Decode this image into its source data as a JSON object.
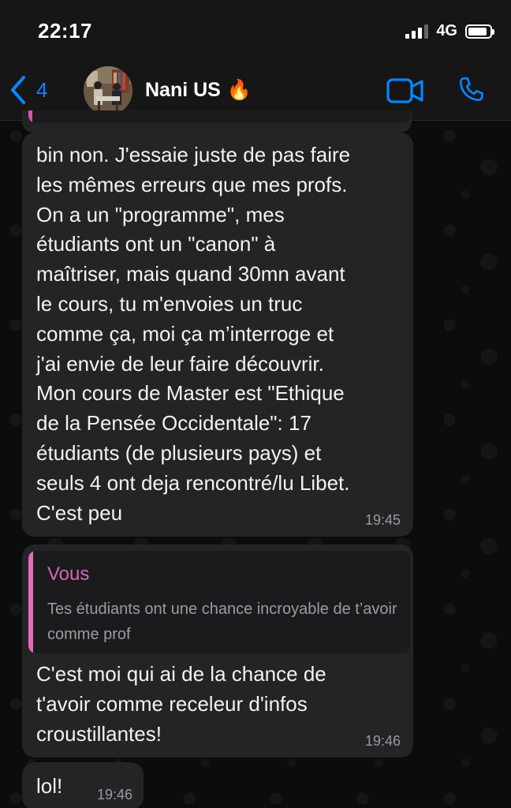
{
  "status_bar": {
    "time": "22:17",
    "network": "4G",
    "battery_level": 0.9
  },
  "header": {
    "back_count": "4",
    "contact_name": "Nani US",
    "contact_emoji": "🔥",
    "icons": {
      "back": "chevron-left-icon",
      "video": "video-camera-icon",
      "phone": "phone-icon"
    },
    "accent_color": "#0a84ff"
  },
  "messages": [
    {
      "text": "bin non. J'essaie juste de pas faire\nles mêmes erreurs que mes profs.\nOn a un \"programme\", mes\nétudiants ont un \"canon\" à\nmaîtriser, mais quand 30mn avant\nle cours, tu m'envoies un truc\ncomme ça, moi ça m’interroge et\nj'ai envie de leur faire découvrir.\nMon cours de Master est \"Ethique\nde la Pensée Occidentale\": 17\nétudiants (de plusieurs pays) et\nseuls 4 ont deja rencontré/lu Libet.\nC'est peu",
      "time": "19:45"
    },
    {
      "quote_author": "Vous",
      "quote_text": "Tes étudiants ont une chance incroyable de t’avoir comme prof",
      "text": "C'est moi qui ai de la chance de\nt'avoir comme receleur d'infos\ncroustillantes!",
      "time": "19:46"
    },
    {
      "text": "lol!",
      "time": "19:46"
    }
  ],
  "colors": {
    "bubble": "#242426",
    "quote_accent": "#e36bb8",
    "background": "#0c0c0c"
  }
}
